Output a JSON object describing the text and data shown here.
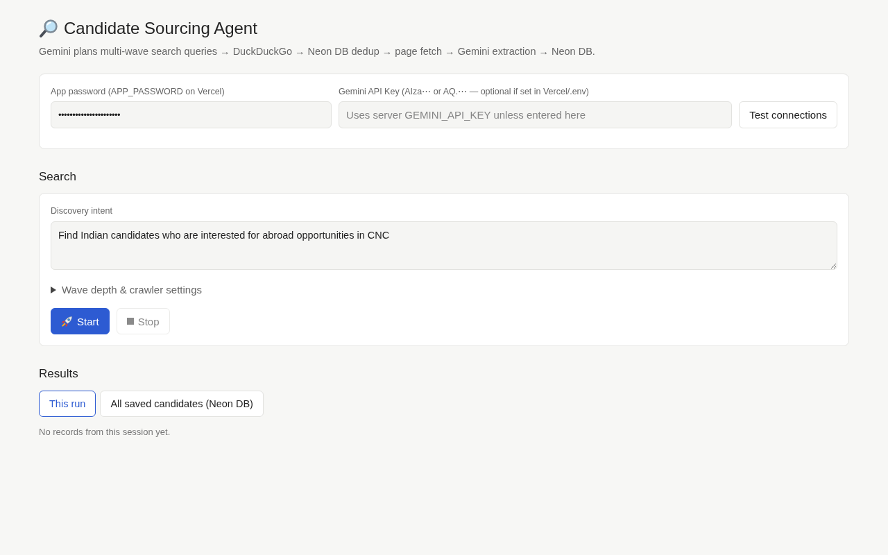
{
  "header": {
    "title": "Candidate Sourcing Agent",
    "subtitle": "Gemini plans multi-wave search queries → DuckDuckGo → Neon DB dedup → page fetch → Gemini extraction → Neon DB."
  },
  "connection": {
    "password": {
      "label": "App password (APP_PASSWORD on Vercel)",
      "value": "••••••••••••••••••••••"
    },
    "api_key": {
      "label": "Gemini API Key (AIza⋯ or AQ.⋯ — optional if set in Vercel/.env)",
      "placeholder": "Uses server GEMINI_API_KEY unless entered here"
    },
    "test_button": "Test connections"
  },
  "search": {
    "heading": "Search",
    "intent": {
      "label": "Discovery intent",
      "value": "Find Indian candidates who are interested for abroad opportunities in CNC"
    },
    "settings": {
      "label": "Wave depth & crawler settings",
      "expanded": false
    },
    "actions": [
      {
        "label": "Start",
        "kind": "start",
        "disabled": false
      },
      {
        "label": "Stop",
        "kind": "stop",
        "disabled": true
      }
    ]
  },
  "results": {
    "heading": "Results",
    "tabs": [
      {
        "label": "This run",
        "selected": true
      },
      {
        "label": "All saved candidates (Neon DB)",
        "selected": false
      }
    ],
    "empty_message": "No records from this session yet."
  }
}
